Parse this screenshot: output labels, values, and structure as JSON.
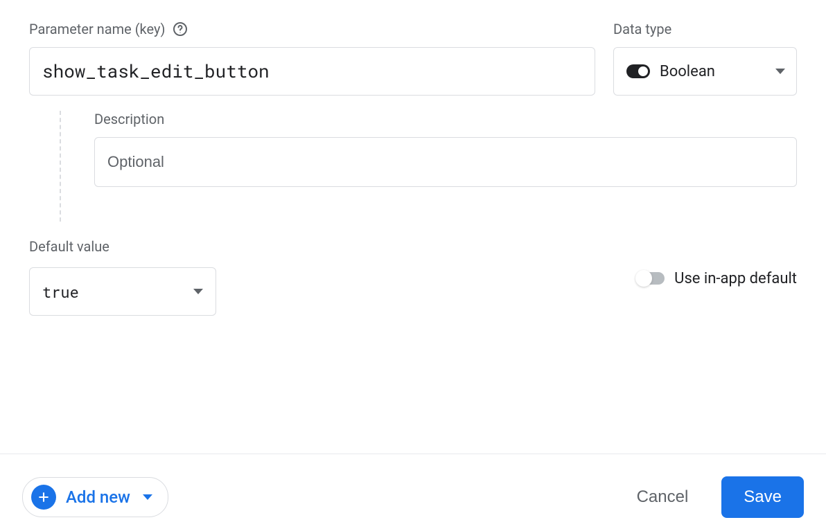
{
  "labels": {
    "parameter_name": "Parameter name (key)",
    "data_type": "Data type",
    "description": "Description",
    "default_value": "Default value",
    "use_in_app_default": "Use in-app default"
  },
  "fields": {
    "parameter_name_value": "show_task_edit_button",
    "data_type_value": "Boolean",
    "description_placeholder": "Optional",
    "description_value": "",
    "default_value_selected": "true",
    "use_in_app_default_enabled": false
  },
  "footer": {
    "add_new": "Add new",
    "cancel": "Cancel",
    "save": "Save"
  }
}
